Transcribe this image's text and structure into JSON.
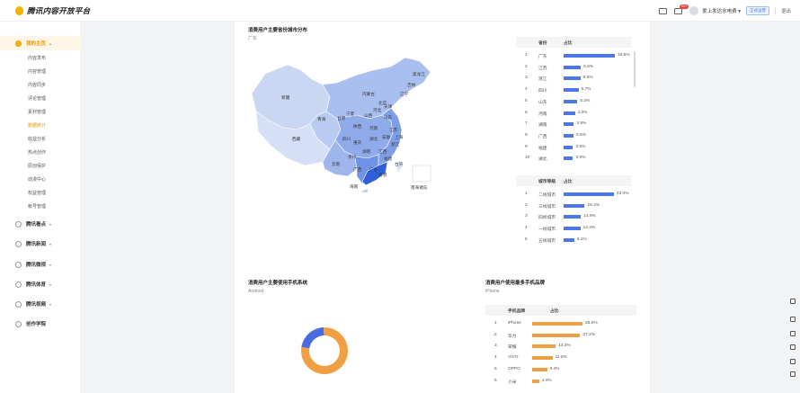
{
  "app": {
    "title": "腾讯内容开放平台"
  },
  "header": {
    "badge": "99+",
    "user_name": "爱上发达水电费",
    "user_caret": "▾",
    "account_type": "正式运营",
    "logout": "退出"
  },
  "sidebar": {
    "groups": [
      {
        "label": "我的主页",
        "active": true
      },
      {
        "label": "腾讯看点"
      },
      {
        "label": "腾讯新闻"
      },
      {
        "label": "腾讯微视"
      },
      {
        "label": "腾讯体育"
      },
      {
        "label": "腾讯视频"
      },
      {
        "label": "创作学院"
      }
    ],
    "items": [
      "内容发布",
      "内容管理",
      "内容同步",
      "评论管理",
      "素材管理",
      "数据统计",
      "收益分析",
      "热点创作",
      "原创保护",
      "动漫中心",
      "权益管理",
      "帐号管理"
    ],
    "active_item": "数据统计"
  },
  "city_dist": {
    "title": "消费用户主要省份城市分布",
    "subtitle": "广东",
    "map_labels": [
      "黑龙江",
      "吉林",
      "辽宁",
      "内蒙古",
      "新疆",
      "北京",
      "天津",
      "河北",
      "山西",
      "山东",
      "宁夏",
      "甘肃",
      "陕西",
      "青海",
      "河南",
      "江苏",
      "上海",
      "安徽",
      "湖北",
      "浙江",
      "四川",
      "重庆",
      "西藏",
      "湖南",
      "江西",
      "贵州",
      "福建",
      "云南",
      "广西",
      "广东",
      "香港",
      "台湾",
      "海南",
      "南海诸岛"
    ]
  },
  "province_table": {
    "headers": [
      "省份",
      "占比"
    ],
    "rows": [
      {
        "rank": "1",
        "name": "广东",
        "value": 19.6,
        "label": "19.6%"
      },
      {
        "rank": "2",
        "name": "江苏",
        "value": 6.6,
        "label": "6.6%"
      },
      {
        "rank": "3",
        "name": "浙江",
        "value": 6.5,
        "label": "6.5%"
      },
      {
        "rank": "4",
        "name": "四川",
        "value": 5.7,
        "label": "5.7%"
      },
      {
        "rank": "5",
        "name": "山东",
        "value": 5.3,
        "label": "5.3%"
      },
      {
        "rank": "6",
        "name": "河南",
        "value": 4.3,
        "label": "4.3%"
      },
      {
        "rank": "7",
        "name": "湖南",
        "value": 3.9,
        "label": "3.9%"
      },
      {
        "rank": "8",
        "name": "广西",
        "value": 3.8,
        "label": "3.8%"
      },
      {
        "rank": "9",
        "name": "福建",
        "value": 3.6,
        "label": "3.6%"
      },
      {
        "rank": "10",
        "name": "湖北",
        "value": 3.6,
        "label": "3.6%"
      }
    ]
  },
  "city_tier_table": {
    "headers": [
      "城市等级",
      "占比"
    ],
    "rows": [
      {
        "rank": "1",
        "name": "二线城市",
        "value": 43.4,
        "label": "43.4%"
      },
      {
        "rank": "2",
        "name": "三线城市",
        "value": 18.2,
        "label": "18.2%"
      },
      {
        "rank": "3",
        "name": "四线城市",
        "value": 14.9,
        "label": "14.9%"
      },
      {
        "rank": "4",
        "name": "一线城市",
        "value": 14.4,
        "label": "14.4%"
      },
      {
        "rank": "5",
        "name": "五线城市",
        "value": 9.1,
        "label": "9.1%"
      }
    ]
  },
  "os_panel": {
    "title": "消费用户主要使用手机系统",
    "subtitle": "Android"
  },
  "chart_data": {
    "type": "pie",
    "style": "donut",
    "categories": [
      "Android",
      "iOS"
    ],
    "values": [
      78,
      22
    ],
    "colors": [
      "#f0a043",
      "#4a6be0"
    ]
  },
  "brand_panel": {
    "title": "消费用户使用最多手机品牌",
    "subtitle": "iPhone",
    "headers": [
      "手机品牌",
      "占比"
    ],
    "rows": [
      {
        "rank": "1",
        "name": "iPhone",
        "value": 28.5,
        "label": "28.5%"
      },
      {
        "rank": "2",
        "name": "华为",
        "value": 27.2,
        "label": "27.2%"
      },
      {
        "rank": "3",
        "name": "荣耀",
        "value": 13.3,
        "label": "13.3%"
      },
      {
        "rank": "4",
        "name": "VIVO",
        "value": 11.5,
        "label": "11.5%"
      },
      {
        "rank": "5",
        "name": "OPPO",
        "value": 8.4,
        "label": "8.4%"
      },
      {
        "rank": "6",
        "name": "小米",
        "value": 4.0,
        "label": "4.0%"
      }
    ]
  },
  "colors": {
    "accent": "#f5b400",
    "bar_blue": "#4a78e6",
    "bar_orange": "#f0a043"
  }
}
